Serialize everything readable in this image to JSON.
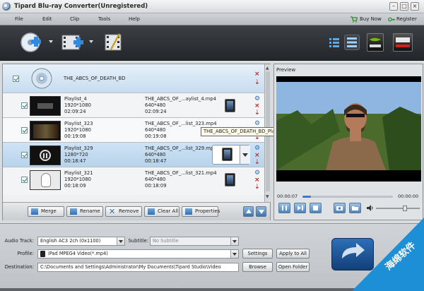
{
  "window": {
    "title": "Tipard Blu-ray Converter(Unregistered)"
  },
  "menu": {
    "items": [
      "File",
      "Edit",
      "Clip",
      "Tools",
      "Help"
    ],
    "buy": "Buy Now",
    "register": "Register"
  },
  "list": {
    "disc_title": "THE_ABCS_OF_DEATH_BD",
    "rows": [
      {
        "name": "Playlist_4",
        "res": "1920*1080",
        "dur": "02:09:24",
        "out": "THE_ABCS_OF_...aylist_4.mp4",
        "ores": "640*480",
        "odur": "02:09:24"
      },
      {
        "name": "Playlist_323",
        "res": "1920*1080",
        "dur": "00:19:08",
        "out": "THE_ABCS_OF_...list_323.mp4",
        "ores": "640*480",
        "odur": "00:19:08"
      },
      {
        "name": "Playlist_329",
        "res": "1280*720",
        "dur": "00:18:47",
        "out": "THE_ABCS_OF_...list_329.mp4",
        "ores": "640*480",
        "odur": "00:18:47"
      },
      {
        "name": "Playlist_321",
        "res": "1920*1080",
        "dur": "00:18:09",
        "out": "THE_ABCS_OF_...list_321.mp4",
        "ores": "640*480",
        "odur": "00:18:09"
      }
    ],
    "tooltip": "THE_ABCS_OF_DEATH_BD_Playlist_4.mp4"
  },
  "buttons": {
    "merge": "Merge",
    "rename": "Rename",
    "remove": "Remove",
    "clear_all": "Clear All",
    "properties": "Properties"
  },
  "preview": {
    "label": "Preview",
    "time_start": "00:00:07",
    "time_end": "00:00:00"
  },
  "settings": {
    "audio_label": "Audio Track:",
    "audio_value": "English AC3 2ch (0x1100)",
    "subtitle_label": "Subtitle:",
    "subtitle_value": "No Subtitle",
    "profile_label": "Profile:",
    "profile_value": "iPad MPEG4 Video(*.mp4)",
    "settings_btn": "Settings",
    "apply_btn": "Apply to All",
    "dest_label": "Destination:",
    "dest_value": "C:\\Documents and Settings\\Administrator\\My Documents\\Tipard Studio\\Video",
    "browse_btn": "Browse",
    "open_btn": "Open Folder"
  },
  "watermark": {
    "text": "海绵软件"
  },
  "colors": {
    "accent": "#3a7bd5",
    "toolbar": "#2b2e33",
    "watermark": "#1d8fd6"
  }
}
